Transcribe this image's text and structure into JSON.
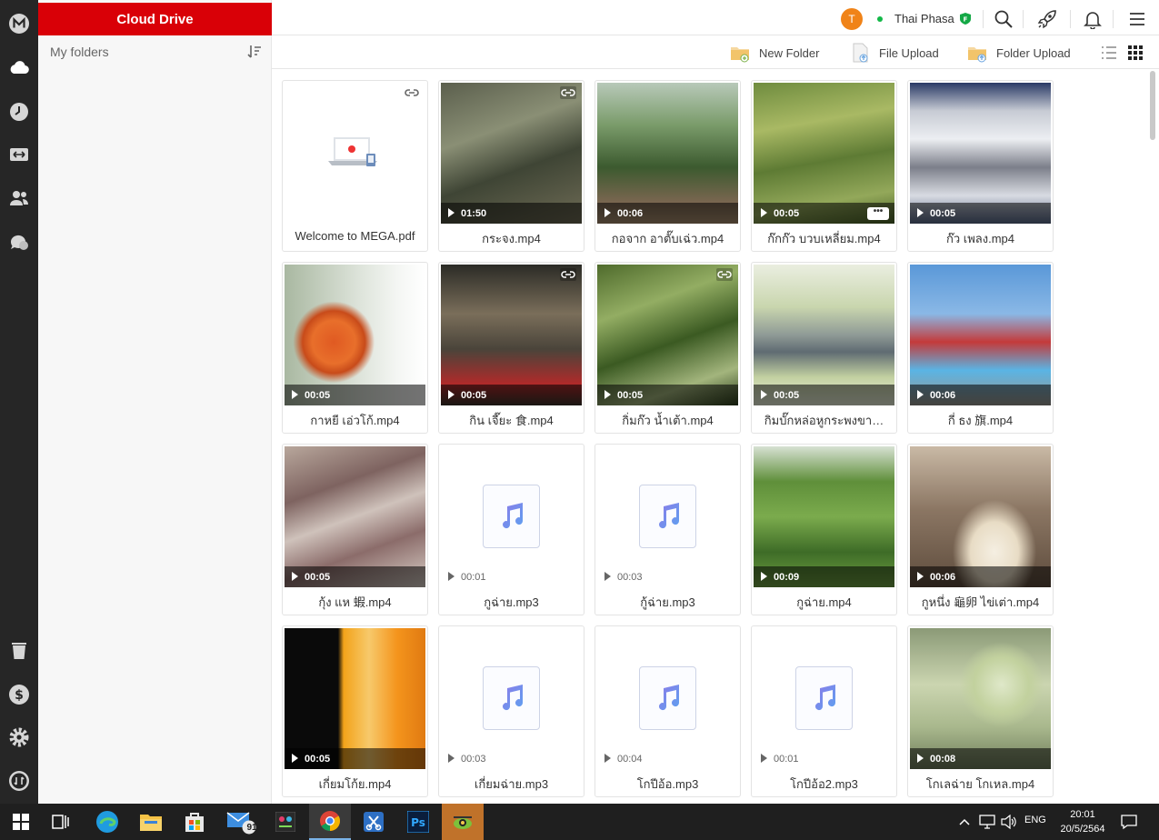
{
  "app": {
    "section_title": "Cloud Drive",
    "my_folders_label": "My folders"
  },
  "user": {
    "initial": "T",
    "name": "Thai Phasa",
    "status_color": "#13b848",
    "avatar_color": "#f08318"
  },
  "toolbar": {
    "new_folder": "New Folder",
    "file_upload": "File Upload",
    "folder_upload": "Folder Upload"
  },
  "colors": {
    "brand_red": "#d90007",
    "rail_bg": "#262626"
  },
  "files": [
    {
      "name": "Welcome to MEGA.pdf",
      "type": "pdf",
      "duration": "",
      "linked": true
    },
    {
      "name": "กระจง.mp4",
      "type": "video",
      "duration": "01:50",
      "linked": true,
      "thumb": "forest"
    },
    {
      "name": "กอจาก อาตั๊บเฉ่ว.mp4",
      "type": "video",
      "duration": "00:06",
      "linked": false,
      "thumb": "palms"
    },
    {
      "name": "ก๊กก๊ว บวบเหลี่ยม.mp4",
      "type": "video",
      "duration": "00:05",
      "linked": false,
      "thumb": "greens",
      "menu": "•••"
    },
    {
      "name": "ก๊ว เพลง.mp4",
      "type": "video",
      "duration": "00:05",
      "linked": false,
      "thumb": "screen"
    },
    {
      "name": "กาหยี เอ่วโก้.mp4",
      "type": "video",
      "duration": "00:05",
      "linked": false,
      "thumb": "cashew"
    },
    {
      "name": "กิน เจี๊ยะ 食.mp4",
      "type": "video",
      "duration": "00:05",
      "linked": true,
      "thumb": "photo"
    },
    {
      "name": "กิ่มก๊ว น้ำเต้า.mp4",
      "type": "video",
      "duration": "00:05",
      "linked": true,
      "thumb": "vine"
    },
    {
      "name": "กิมบั๊กหล่อหูกระพงขา…",
      "type": "video",
      "duration": "00:05",
      "linked": false,
      "thumb": "fish"
    },
    {
      "name": "กี่ ธง 旗.mp4",
      "type": "video",
      "duration": "00:06",
      "linked": false,
      "thumb": "flags"
    },
    {
      "name": "กุ้ง แห 蝦.mp4",
      "type": "video",
      "duration": "00:05",
      "linked": false,
      "thumb": "shrimp"
    },
    {
      "name": "กูฉ่าย.mp3",
      "type": "audio",
      "duration": "00:01",
      "linked": false
    },
    {
      "name": "กู้ฉ่าย.mp3",
      "type": "audio",
      "duration": "00:03",
      "linked": false
    },
    {
      "name": "กูฉ่าย.mp4",
      "type": "video",
      "duration": "00:09",
      "linked": false,
      "thumb": "chives"
    },
    {
      "name": "กูหนึ่ง 龜卵 ไข่เต่า.mp4",
      "type": "video",
      "duration": "00:06",
      "linked": false,
      "thumb": "eggs"
    },
    {
      "name": "เกี่ยมโก้ย.mp4",
      "type": "video",
      "duration": "00:05",
      "linked": false,
      "thumb": "saltegg"
    },
    {
      "name": "เกี่ยมฉ่าย.mp3",
      "type": "audio",
      "duration": "00:03",
      "linked": false
    },
    {
      "name": "โกปีอ้อ.mp3",
      "type": "audio",
      "duration": "00:04",
      "linked": false
    },
    {
      "name": "โกปีอ้อ2.mp3",
      "type": "audio",
      "duration": "00:01",
      "linked": false
    },
    {
      "name": "โกเลฉ่าย โกเหล.mp4",
      "type": "video",
      "duration": "00:08",
      "linked": false,
      "thumb": "cabbage"
    }
  ],
  "taskbar": {
    "mail_badge": "91",
    "lang": "ENG",
    "time": "20:01",
    "date": "20/5/2564"
  }
}
